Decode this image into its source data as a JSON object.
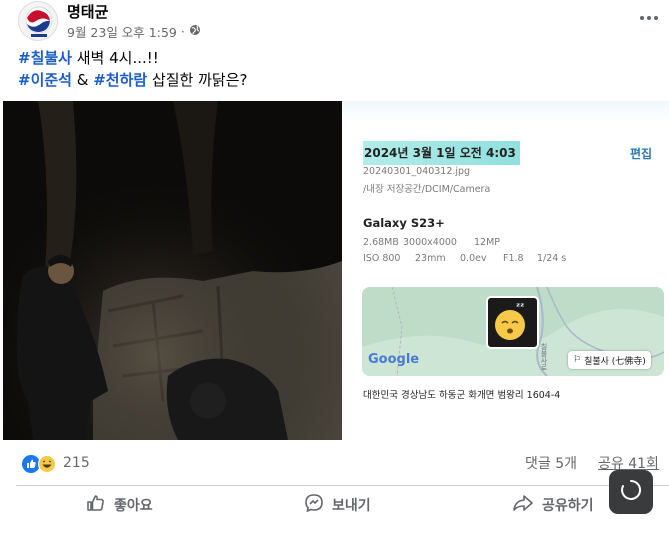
{
  "post": {
    "author": "명태균",
    "timestamp": "9월 23일 오후 1:59",
    "audience_separator": "·",
    "audience_icon": "globe-icon",
    "more_icon": "more-options-icon",
    "text_line1": {
      "tag": "#칠불사",
      "rest": " 새벽 4시...!!"
    },
    "text_line2": {
      "tag1": "#이준석",
      "mid": " & ",
      "tag2": "#천하람",
      "rest": " 삽질한 까닭은?"
    }
  },
  "metadata_panel": {
    "datetime": "2024년 3월 1일 오전 4:03",
    "edit_label": "편집",
    "filename": "20240301_040312.jpg",
    "path": "/내장 저장공간/DCIM/Camera",
    "device": "Galaxy S23+",
    "specs_row1": [
      "2.68MB",
      "3000x4000",
      "12MP"
    ],
    "specs_row2": [
      "ISO 800",
      "23mm",
      "0.0ev",
      "F1.8",
      "1/24 s"
    ],
    "map": {
      "provider_logo": "Google",
      "place_label": "칠불사 (七佛寺)",
      "road_label": "칠불사로",
      "pin_emoji": "😴"
    },
    "address": "대한민국 경상남도 하동군 화개면 범왕리 1604-4"
  },
  "engagement": {
    "reaction_icons": [
      "like-icon",
      "haha-icon"
    ],
    "reaction_count": "215",
    "comments": "댓글 5개",
    "shares": "공유 41회"
  },
  "actions": {
    "like": "좋아요",
    "send": "보내기",
    "share": "공유하기"
  },
  "colors": {
    "hashtag": "#1c5ec9",
    "edit_link": "#2b79b4",
    "highlight": "#a6e8e6",
    "muted_text": "#65676b"
  }
}
